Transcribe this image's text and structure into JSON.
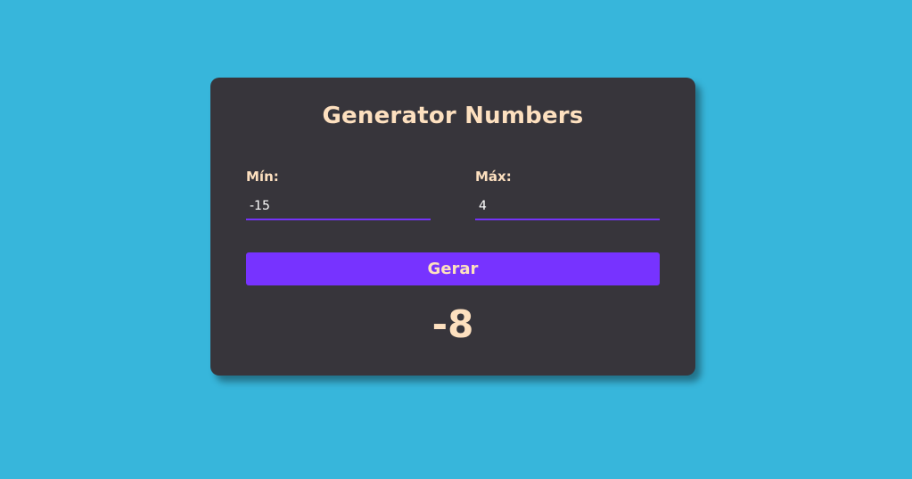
{
  "app": {
    "title": "Generator Numbers"
  },
  "form": {
    "min_label": "Mín:",
    "min_value": "-15",
    "max_label": "Máx:",
    "max_value": "4",
    "button_label": "Gerar"
  },
  "result": {
    "value": "-8"
  },
  "colors": {
    "background": "#37b6db",
    "card": "#37353b",
    "accent": "#7733ff",
    "text": "#fde0bf"
  }
}
